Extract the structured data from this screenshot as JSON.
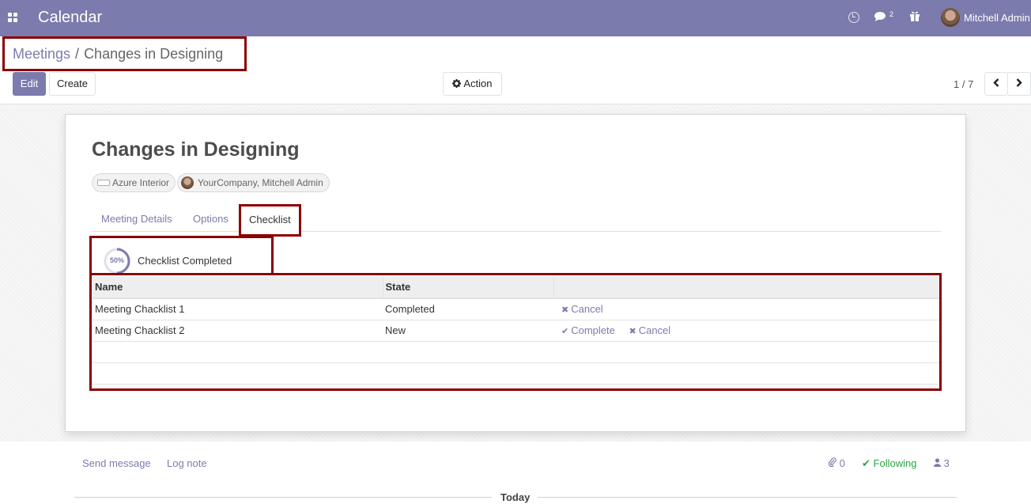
{
  "app": {
    "title": "Calendar"
  },
  "systray": {
    "messages_badge": "2",
    "user_name": "Mitchell Admin"
  },
  "breadcrumb": {
    "parent": "Meetings",
    "separator": "/",
    "current": "Changes in Designing"
  },
  "buttons": {
    "edit": "Edit",
    "create": "Create",
    "action": "Action"
  },
  "pager": {
    "value": "1 / 7"
  },
  "record": {
    "title": "Changes in Designing",
    "tags": [
      "Azure Interior",
      "YourCompany, Mitchell Admin"
    ]
  },
  "tabs": [
    "Meeting Details",
    "Options",
    "Checklist"
  ],
  "active_tab": "Checklist",
  "checklist": {
    "progress_percent": 50,
    "progress_label": "50%",
    "status_text": "Checklist Completed",
    "columns": [
      "Name",
      "State",
      ""
    ],
    "rows": [
      {
        "name": "Meeting Chacklist 1",
        "state": "Completed",
        "actions": [
          "Cancel"
        ]
      },
      {
        "name": "Meeting Chacklist 2",
        "state": "New",
        "actions": [
          "Complete",
          "Cancel"
        ]
      }
    ]
  },
  "chatter": {
    "send_message": "Send message",
    "log_note": "Log note",
    "attachments": "0",
    "following": "Following",
    "followers": "3",
    "date_separator": "Today"
  },
  "colors": {
    "brand": "#7c7bad",
    "highlight": "#8b0000",
    "following": "#28a745"
  },
  "icons": [
    "apps-icon",
    "clock-icon",
    "chat-icon",
    "gift-icon",
    "gear-icon",
    "chevron-left-icon",
    "chevron-right-icon",
    "times-icon",
    "check-icon",
    "paperclip-icon",
    "user-icon"
  ]
}
